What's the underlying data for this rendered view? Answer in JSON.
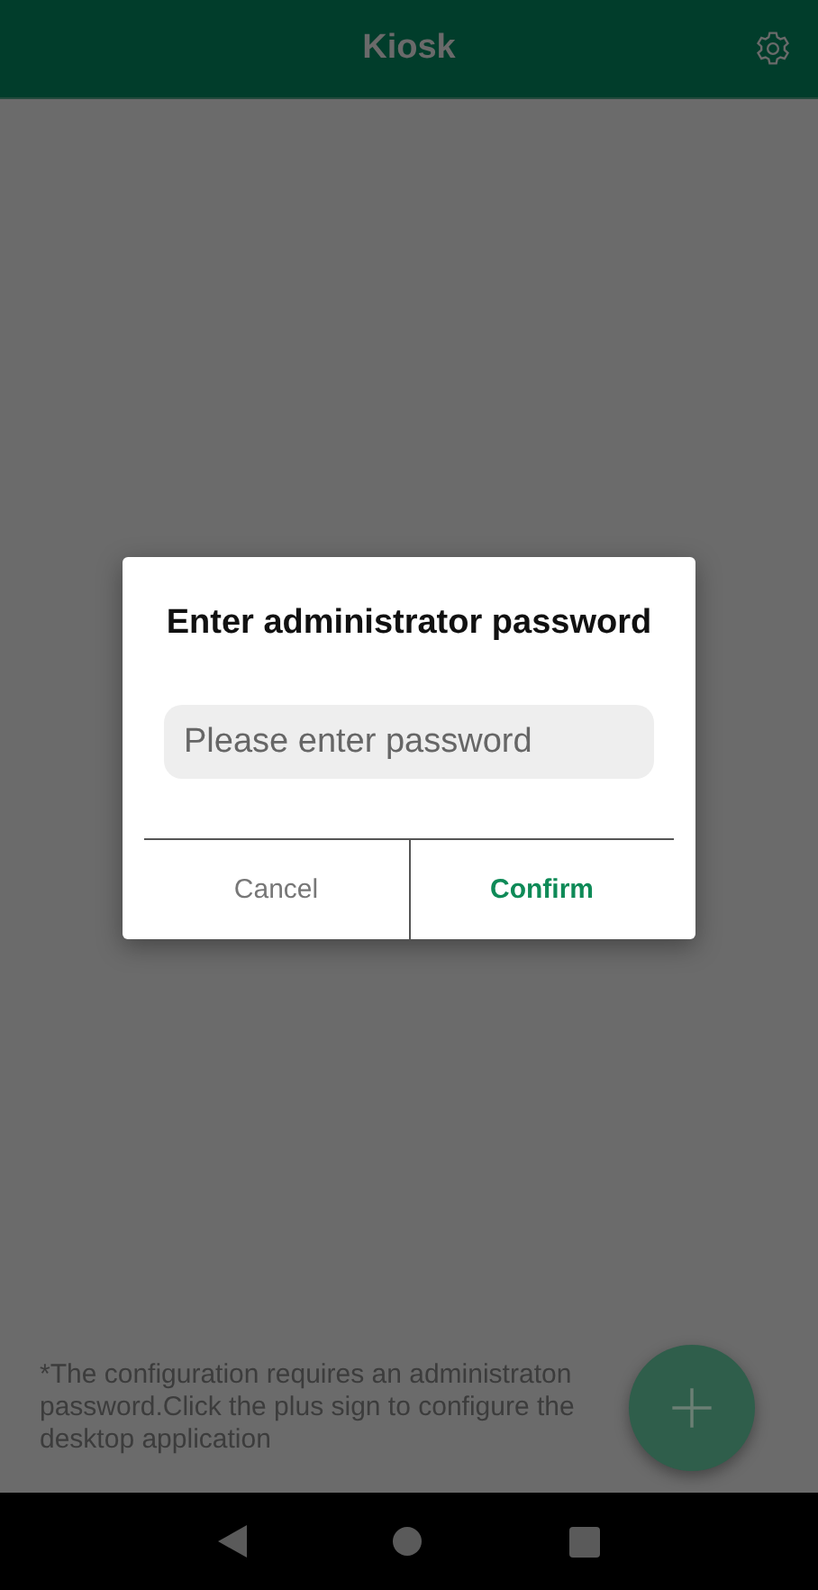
{
  "app_bar": {
    "title": "Kiosk"
  },
  "dialog": {
    "title": "Enter administrator password",
    "password_field": {
      "placeholder": "Please enter password"
    },
    "buttons": [
      {
        "label": "Cancel",
        "kind": "secondary"
      },
      {
        "label": "Confirm",
        "kind": "primary"
      }
    ]
  },
  "hint": "*The configuration requires an administraton password.Click the plus sign to configure the desktop application"
}
